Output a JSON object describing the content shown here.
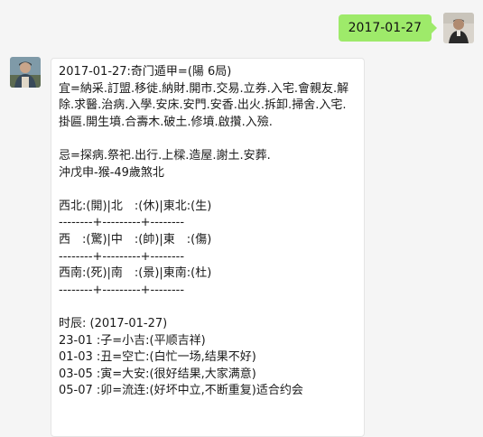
{
  "outgoing": {
    "text": "2017-01-27"
  },
  "incoming": {
    "header": "2017-01-27:奇门遁甲=(陽 6局)",
    "yi": "宜=納采.訂盟.移徙.納財.開市.交易.立券.入宅.會親友.解除.求醫.治病.入學.安床.安門.安香.出火.拆卸.掃舍.入宅.掛匾.開生墳.合壽木.破土.修墳.啟攢.入殮.",
    "ji": "忌=探病.祭祀.出行.上樑.造屋.謝土.安葬.",
    "chong": "沖戊申-猴-49歲煞北",
    "grid": [
      "西北:(開)|北　:(休)|東北:(生)",
      "--------+---------+--------",
      "西　:(驚)|中　:(帥)|東　:(傷)",
      "--------+---------+--------",
      "西南:(死)|南　:(景)|東南:(杜)",
      "--------+---------+--------"
    ],
    "hours_title": "时辰: (2017-01-27)",
    "hours": [
      "23-01 :子=小吉:(平顺吉祥)",
      "01-03 :丑=空亡:(白忙一场,结果不好)",
      "03-05 :寅=大安:(很好结果,大家满意)",
      "05-07 :卯=流连:(好坏中立,不断重复)适合约会"
    ]
  }
}
